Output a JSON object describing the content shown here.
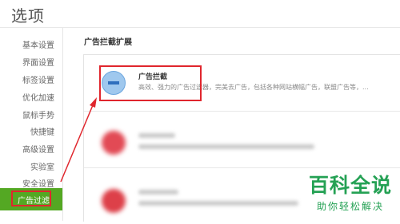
{
  "header": {
    "title": "选项"
  },
  "sidebar": {
    "items": [
      {
        "label": "基本设置"
      },
      {
        "label": "界面设置"
      },
      {
        "label": "标签设置"
      },
      {
        "label": "优化加速"
      },
      {
        "label": "鼠标手势"
      },
      {
        "label": "快捷键"
      },
      {
        "label": "高级设置"
      },
      {
        "label": "实验室"
      },
      {
        "label": "安全设置"
      },
      {
        "label": "广告过滤"
      }
    ],
    "active_index": 9
  },
  "main": {
    "section_title": "广告拦截扩展",
    "extensions": [
      {
        "name": "广告拦截",
        "description": "高效、强力的广告过滤器，完美去广告，包括各种网站横幅广告，联盟广告等，..."
      }
    ]
  },
  "colors": {
    "active_bg": "#54a823",
    "annotation_red": "#e0262d",
    "watermark_green": "#24a154"
  },
  "watermark": {
    "title": "百科全说",
    "subtitle": "助你轻松解决"
  }
}
